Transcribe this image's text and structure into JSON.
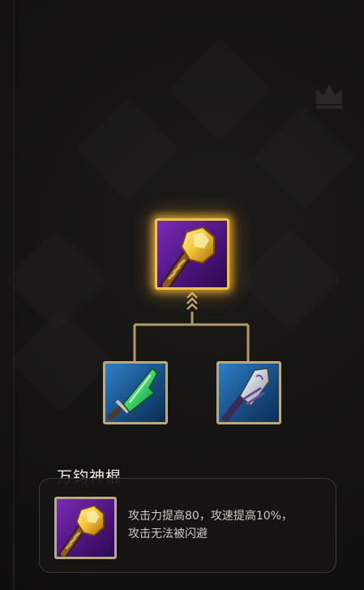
{
  "item": {
    "name": "万钧神棍",
    "icon": "golden-club-icon",
    "rarity_color": "#f2c34a",
    "description_lines": [
      "攻击力提高80，攻速提高10%，",
      "攻击无法被闪避"
    ]
  },
  "recipe": {
    "result": {
      "icon": "golden-club-icon",
      "rarity": "epic",
      "selected": true
    },
    "components": [
      {
        "icon": "green-blade-icon",
        "rarity": "rare"
      },
      {
        "icon": "silver-club-icon",
        "rarity": "rare"
      }
    ]
  },
  "colors": {
    "background": "#121111",
    "connector": "#b09a68",
    "frame": "#b9ab7e",
    "epic_bg": "#6a2aa6",
    "rare_bg": "#1f6aad"
  }
}
